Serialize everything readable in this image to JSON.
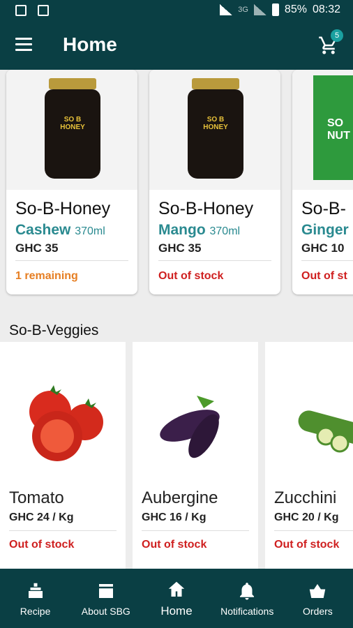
{
  "status_bar": {
    "battery": "85%",
    "time": "08:32",
    "network": "3G"
  },
  "appbar": {
    "title": "Home",
    "cart_count": "5"
  },
  "honey_products": [
    {
      "name": "So-B-Honey",
      "variant": "Cashew",
      "size": "370ml",
      "price": "GHC 35",
      "status": "1 remaining",
      "status_color": "#e67e22",
      "jar_label": "SO B HONEY"
    },
    {
      "name": "So-B-Honey",
      "variant": "Mango",
      "size": "370ml",
      "price": "GHC 35",
      "status": "Out of stock",
      "status_color": "#cf1f1f",
      "jar_label": "SO B HONEY"
    },
    {
      "name": "So-B-",
      "variant": "Ginger",
      "size": "",
      "price": "GHC 10",
      "status": "Out of st",
      "status_color": "#cf1f1f",
      "jar_label": "SO NUT"
    }
  ],
  "veggies_section": {
    "title": "So-B-Veggies"
  },
  "veggies": [
    {
      "name": "Tomato",
      "price": "GHC 24 / Kg",
      "status": "Out of stock"
    },
    {
      "name": "Aubergine",
      "price": "GHC 16 / Kg",
      "status": "Out of stock"
    },
    {
      "name": "Zucchini",
      "price": "GHC 20 / Kg",
      "status": "Out of stock"
    }
  ],
  "bottom_nav": [
    {
      "label": "Recipe",
      "icon": "recipe-icon"
    },
    {
      "label": "About SBG",
      "icon": "store-icon"
    },
    {
      "label": "Home",
      "icon": "home-icon"
    },
    {
      "label": "Notifications",
      "icon": "bell-icon"
    },
    {
      "label": "Orders",
      "icon": "basket-icon"
    }
  ],
  "colors": {
    "primary": "#0a3f44",
    "accent": "#2a8a90",
    "out_of_stock": "#cf1f1f",
    "low_stock": "#e67e22"
  }
}
